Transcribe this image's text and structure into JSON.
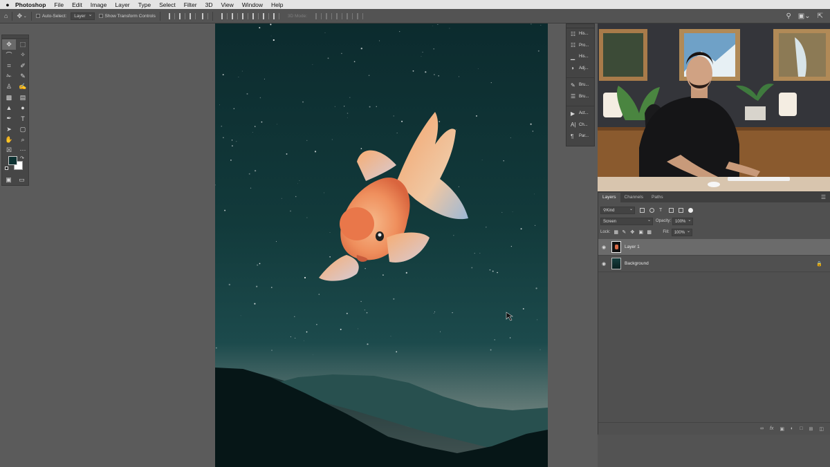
{
  "menubar": {
    "apple_icon": "apple-logo-icon",
    "app_name": "Photoshop",
    "items": [
      "File",
      "Edit",
      "Image",
      "Layer",
      "Type",
      "Select",
      "Filter",
      "3D",
      "View",
      "Window",
      "Help"
    ]
  },
  "options_bar": {
    "auto_select_label": "Auto-Select:",
    "auto_select_value": "Layer",
    "show_transform_label": "Show Transform Controls",
    "mode_3d_label": "3D Mode:"
  },
  "tools": [
    "move-tool-icon",
    "marquee-tool-icon",
    "lasso-tool-icon",
    "magic-wand-tool-icon",
    "crop-tool-icon",
    "eyedropper-tool-icon",
    "healing-brush-tool-icon",
    "brush-tool-icon",
    "clone-stamp-tool-icon",
    "history-brush-tool-icon",
    "eraser-tool-icon",
    "gradient-tool-icon",
    "blur-tool-icon",
    "dodge-tool-icon",
    "pen-tool-icon",
    "type-tool-icon",
    "path-selection-tool-icon",
    "rectangle-tool-icon",
    "hand-tool-icon",
    "zoom-tool-icon",
    "frame-tool-icon",
    "more-tools-icon"
  ],
  "colors": {
    "foreground": "#0d3232",
    "background": "#ffffff"
  },
  "panel_strip": {
    "group1": [
      {
        "icon": "history-icon",
        "label": "His..."
      },
      {
        "icon": "properties-icon",
        "label": "Pro..."
      },
      {
        "icon": "histogram-icon",
        "label": "His..."
      },
      {
        "icon": "adjustments-icon",
        "label": "Adj..."
      }
    ],
    "group2": [
      {
        "icon": "brush-icon",
        "label": "Bru..."
      },
      {
        "icon": "brush-settings-icon",
        "label": "Bru..."
      }
    ],
    "group3": [
      {
        "icon": "actions-icon",
        "label": "Act..."
      },
      {
        "icon": "character-icon",
        "label": "Ch..."
      },
      {
        "icon": "paragraph-icon",
        "label": "Par..."
      }
    ]
  },
  "layers_panel": {
    "tabs": [
      "Layers",
      "Channels",
      "Paths"
    ],
    "active_tab": "Layers",
    "filter_kind": "Kind",
    "blend_mode": "Screen",
    "opacity_label": "Opacity:",
    "opacity_value": "100%",
    "lock_label": "Lock:",
    "fill_label": "Fill:",
    "fill_value": "100%",
    "layers": [
      {
        "name": "Layer 1",
        "selected": true,
        "visible": true,
        "locked": false
      },
      {
        "name": "Background",
        "selected": false,
        "visible": true,
        "locked": true
      }
    ],
    "footer_icons": [
      "link-layers-icon",
      "fx-icon",
      "mask-icon",
      "adjustment-layer-icon",
      "group-icon",
      "new-layer-icon",
      "trash-icon"
    ],
    "fx_label": "fx"
  },
  "accent": "#6b6b6b"
}
